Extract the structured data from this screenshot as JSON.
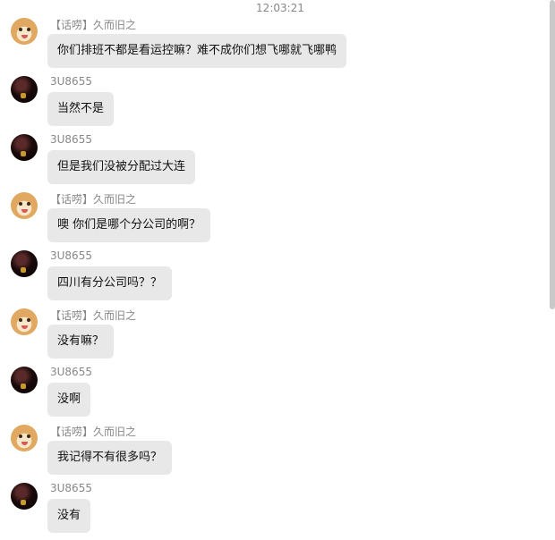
{
  "timestamp": "12:03:21",
  "messages": [
    {
      "sender": "【话唠】久而旧之",
      "avatar": "dog",
      "text": "你们排班不都是看运控嘛？难不成你们想飞哪就飞哪鸭"
    },
    {
      "sender": "3U8655",
      "avatar": "dark",
      "text": "当然不是"
    },
    {
      "sender": "3U8655",
      "avatar": "dark",
      "text": "但是我们没被分配过大连"
    },
    {
      "sender": "【话唠】久而旧之",
      "avatar": "dog",
      "text": "噢 你们是哪个分公司的啊？"
    },
    {
      "sender": "3U8655",
      "avatar": "dark",
      "text": "四川有分公司吗？？"
    },
    {
      "sender": "【话唠】久而旧之",
      "avatar": "dog",
      "text": "没有嘛？"
    },
    {
      "sender": "3U8655",
      "avatar": "dark",
      "text": "没啊"
    },
    {
      "sender": "【话唠】久而旧之",
      "avatar": "dog",
      "text": "我记得不有很多吗？"
    },
    {
      "sender": "3U8655",
      "avatar": "dark",
      "text": "没有"
    }
  ]
}
